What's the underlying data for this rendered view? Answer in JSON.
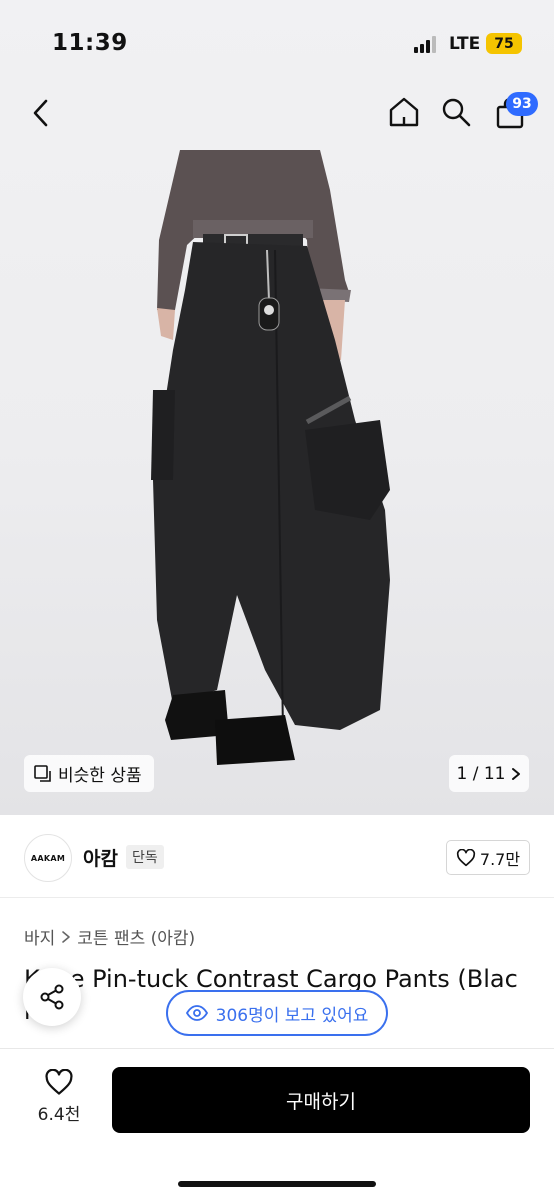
{
  "status_bar": {
    "time": "11:39",
    "network": "LTE",
    "battery": "75"
  },
  "header": {
    "cart_badge": "93"
  },
  "gallery": {
    "similar_label": "비슷한 상품",
    "page_counter": "1 / 11"
  },
  "brand": {
    "logo_text": "AAKAM",
    "name": "아캄",
    "tag": "단독",
    "likes": "7.7만"
  },
  "breadcrumb": {
    "category": "바지",
    "subcategory": "코튼 팬츠 (아캄)"
  },
  "product": {
    "title_line1": "Knee Pin-tuck Contrast Cargo Pants (Blac",
    "title_line2": "k)",
    "viewers": "306명이 보고 있어요"
  },
  "bottom": {
    "likes": "6.4천",
    "buy_label": "구매하기"
  },
  "colors": {
    "accent": "#3a70ee",
    "badge": "#2f6bff",
    "battery": "#f5c400",
    "buy_button": "#000000"
  },
  "icons": [
    "back-icon",
    "home-icon",
    "search-icon",
    "cart-icon",
    "similar-icon",
    "chevron-right-icon",
    "heart-icon",
    "share-icon",
    "eye-icon"
  ]
}
